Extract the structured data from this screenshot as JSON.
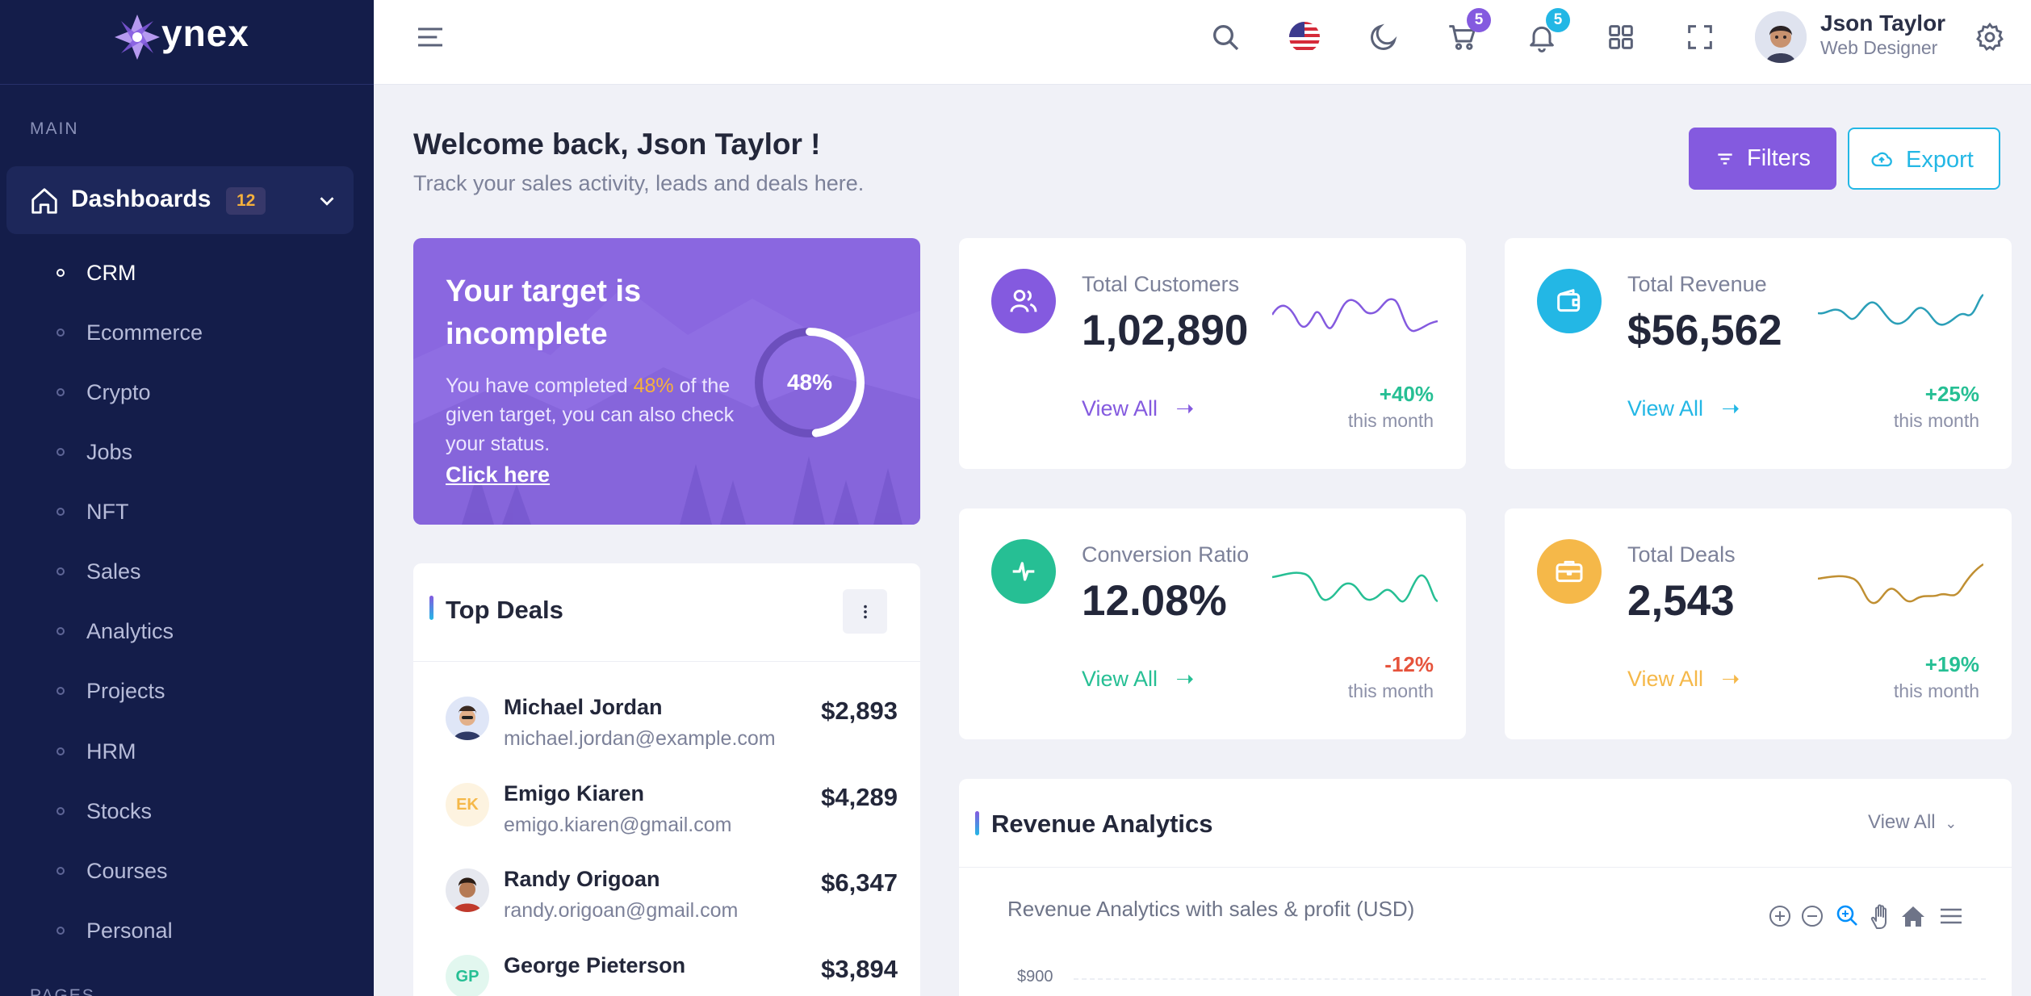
{
  "app": {
    "logo_text": "ynex"
  },
  "sidebar": {
    "category_main": "MAIN",
    "dashboards": {
      "label": "Dashboards",
      "badge": "12"
    },
    "items": [
      {
        "label": "CRM",
        "active": true
      },
      {
        "label": "Ecommerce"
      },
      {
        "label": "Crypto"
      },
      {
        "label": "Jobs"
      },
      {
        "label": "NFT"
      },
      {
        "label": "Sales"
      },
      {
        "label": "Analytics"
      },
      {
        "label": "Projects"
      },
      {
        "label": "HRM"
      },
      {
        "label": "Stocks"
      },
      {
        "label": "Courses"
      },
      {
        "label": "Personal"
      }
    ],
    "category_pages": "PAGES"
  },
  "header": {
    "cart_count": "5",
    "notification_count": "5",
    "user_name": "Json Taylor",
    "user_role": "Web Designer"
  },
  "page": {
    "welcome": "Welcome back, Json Taylor !",
    "subtitle": "Track your sales activity, leads and deals here.",
    "filters_label": "Filters",
    "export_label": "Export"
  },
  "target": {
    "title": "Your target is incomplete",
    "desc_before": "You have completed ",
    "desc_pct": "48%",
    "desc_after": " of the given target, you can also check your status.",
    "link": "Click here",
    "progress_label": "48%",
    "progress": 0.48
  },
  "stats": [
    {
      "label": "Total Customers",
      "value": "1,02,890",
      "view_all": "View All",
      "change": "+40%",
      "period": "this month",
      "color": "#845adf",
      "change_color": "#26bf94",
      "icon": "users-icon"
    },
    {
      "label": "Total Revenue",
      "value": "$56,562",
      "view_all": "View All",
      "change": "+25%",
      "period": "this month",
      "color": "#23b7e5",
      "change_color": "#26bf94",
      "icon": "wallet-icon"
    },
    {
      "label": "Conversion Ratio",
      "value": "12.08%",
      "view_all": "View All",
      "change": "-12%",
      "period": "this month",
      "color": "#26bf94",
      "change_color": "#e6533c",
      "icon": "pulse-icon"
    },
    {
      "label": "Total Deals",
      "value": "2,543",
      "view_all": "View All",
      "change": "+19%",
      "period": "this month",
      "color": "#f5b849",
      "change_color": "#26bf94",
      "icon": "briefcase-icon"
    }
  ],
  "top_deals": {
    "title": "Top Deals",
    "items": [
      {
        "name": "Michael Jordan",
        "email": "michael.jordan@example.com",
        "amount": "$2,893"
      },
      {
        "name": "Emigo Kiaren",
        "email": "emigo.kiaren@gmail.com",
        "amount": "$4,289",
        "initials": "EK"
      },
      {
        "name": "Randy Origoan",
        "email": "randy.origoan@gmail.com",
        "amount": "$6,347"
      },
      {
        "name": "George Pieterson",
        "email": "",
        "amount": "$3,894",
        "initials": "GP"
      }
    ]
  },
  "revenue": {
    "title": "Revenue Analytics",
    "view_all": "View All",
    "chart_title": "Revenue Analytics with sales & profit (USD)",
    "ytick_top": "$900"
  },
  "colors": {
    "primary": "#845adf",
    "secondary": "#23b7e5",
    "success": "#26bf94",
    "warning": "#f5b849",
    "danger": "#e6533c",
    "sidebar": "#141d4a"
  }
}
